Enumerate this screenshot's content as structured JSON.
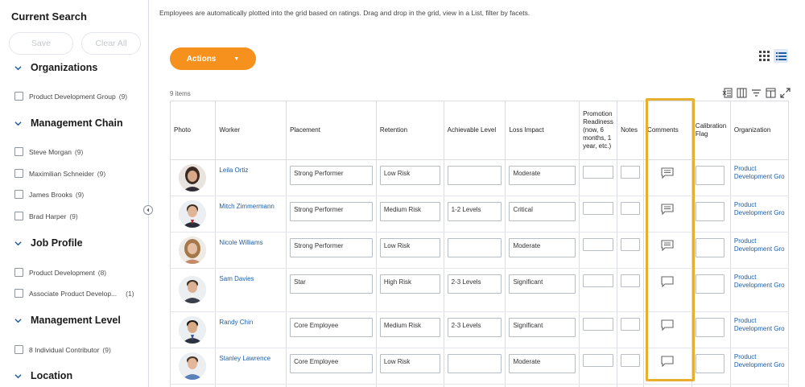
{
  "left_panel": {
    "title": "Current Search",
    "save_label": "Save",
    "clear_all_label": "Clear All",
    "facets": [
      {
        "heading": "Organizations",
        "options": [
          {
            "label": "Product Development Group",
            "count": "(9)"
          }
        ]
      },
      {
        "heading": "Management Chain",
        "options": [
          {
            "label": "Steve Morgan",
            "count": "(9)"
          },
          {
            "label": "Maximilian Schneider",
            "count": "(9)"
          },
          {
            "label": "James Brooks",
            "count": "(9)"
          },
          {
            "label": "Brad Harper",
            "count": "(9)"
          }
        ]
      },
      {
        "heading": "Job Profile",
        "options": [
          {
            "label": "Product Development",
            "count": "(8)"
          },
          {
            "label": "Associate Product Develop...",
            "count": "(1)"
          }
        ]
      },
      {
        "heading": "Management Level",
        "options": [
          {
            "label": "8 Individual Contributor",
            "count": "(9)"
          }
        ]
      },
      {
        "heading": "Location",
        "options": []
      }
    ]
  },
  "main": {
    "instructions": "Employees are automatically plotted into the grid based on ratings.  Drag and drop in the grid, view in a List, filter by facets.",
    "actions_label": "Actions",
    "item_count": "9 items",
    "columns": {
      "photo": "Photo",
      "worker": "Worker",
      "placement": "Placement",
      "retention": "Retention",
      "achievable": "Achievable Level",
      "loss": "Loss Impact",
      "promotion": "Promotion Readiness (now, 6 months, 1 year, etc.)",
      "notes": "Notes",
      "comments": "Comments",
      "calibration": "Calibration Flag",
      "organization": "Organization"
    },
    "rows": [
      {
        "worker": "Leila Ortiz",
        "placement": "Strong Performer",
        "retention": "Low Risk",
        "achievable": "",
        "loss": "Moderate",
        "org1": "Product",
        "org2": "Development Gro"
      },
      {
        "worker": "Mitch Zimmermann",
        "placement": "Strong Performer",
        "retention": "Medium Risk",
        "achievable": "1-2 Levels",
        "loss": "Critical",
        "org1": "Product",
        "org2": "Development Gro"
      },
      {
        "worker": "Nicole Williams",
        "placement": "Strong Performer",
        "retention": "Low Risk",
        "achievable": "",
        "loss": "Moderate",
        "org1": "Product",
        "org2": "Development Gro"
      },
      {
        "worker": "Sam Davies",
        "placement": "Star",
        "retention": "High Risk",
        "achievable": "2-3 Levels",
        "loss": "Significant",
        "org1": "Product",
        "org2": "Development Gro"
      },
      {
        "worker": "Randy Chin",
        "placement": "Core Employee",
        "retention": "Medium Risk",
        "achievable": "2-3 Levels",
        "loss": "Significant",
        "org1": "Product",
        "org2": "Development Gro"
      },
      {
        "worker": "Stanley Lawrence",
        "placement": "Core Employee",
        "retention": "Low Risk",
        "achievable": "",
        "loss": "Moderate",
        "org1": "Product",
        "org2": "Development Gro"
      }
    ]
  },
  "colors": {
    "accent": "#f6911e",
    "link": "#1f5fa6",
    "highlight": "#e8ae2f"
  }
}
